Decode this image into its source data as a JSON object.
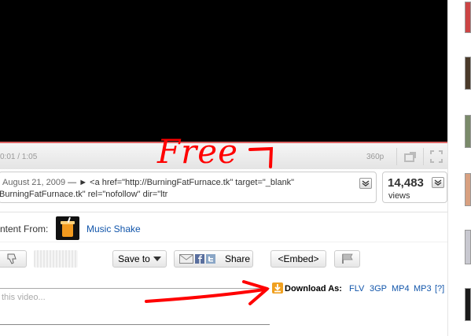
{
  "player": {
    "timecode": "0:01 / 1:05",
    "quality": "360p"
  },
  "description": {
    "date": "August 21, 2009",
    "line1_text": " — ► <a href=\"http://BurningFatFurnace.tk\" target=\"_blank\"",
    "line2_text": "BurningFatFurnace.tk\" rel=\"nofollow\" dir=\"ltr"
  },
  "views": {
    "count": "14,483",
    "label": "views"
  },
  "content_from": {
    "label": "ntent From:",
    "provider": "Music Shake"
  },
  "actions": {
    "save_to": "Save to",
    "share": "Share",
    "embed": "<Embed>"
  },
  "comment": {
    "placeholder": "this video..."
  },
  "download": {
    "label": "Download As:",
    "formats": [
      "FLV",
      "3GP",
      "MP4",
      "MP3",
      "[?]"
    ]
  },
  "annotations": {
    "free": "Free",
    "color": "#ff0000"
  },
  "colors": {
    "link": "#1155aa",
    "progress_accent": "#dd6666"
  }
}
